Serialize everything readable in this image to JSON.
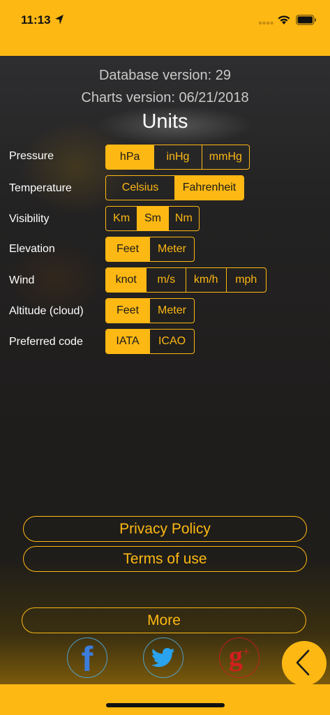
{
  "status_bar": {
    "time": "11:13",
    "icons": [
      "location-arrow-icon",
      "signal-dots-icon",
      "wifi-icon",
      "battery-icon"
    ]
  },
  "info": {
    "database_version": "Database version: 29",
    "charts_version": "Charts version: 06/21/2018"
  },
  "title": "Units",
  "settings": [
    {
      "label": "Pressure",
      "options": [
        "hPa",
        "inHg",
        "mmHg"
      ],
      "selected": 0
    },
    {
      "label": "Temperature",
      "options": [
        "Celsius",
        "Fahrenheit"
      ],
      "selected": 1
    },
    {
      "label": "Visibility",
      "options": [
        "Km",
        "Sm",
        "Nm"
      ],
      "selected": 1
    },
    {
      "label": "Elevation",
      "options": [
        "Feet",
        "Meter"
      ],
      "selected": 0
    },
    {
      "label": "Wind",
      "options": [
        "knot",
        "m/s",
        "km/h",
        "mph"
      ],
      "selected": 0
    },
    {
      "label": "Altitude (cloud)",
      "options": [
        "Feet",
        "Meter"
      ],
      "selected": 0
    },
    {
      "label": "Preferred code",
      "options": [
        "IATA",
        "ICAO"
      ],
      "selected": 0
    }
  ],
  "links": {
    "privacy_policy": "Privacy Policy",
    "terms_of_use": "Terms of use",
    "more": "More"
  },
  "social": {
    "facebook_glyph": "f",
    "twitter_icon": "twitter-bird-icon",
    "gplus_glyph": "g",
    "gplus_sup": "+"
  },
  "colors": {
    "accent": "#fdb813",
    "facebook": "#3b7ddd",
    "twitter": "#2aa3ef",
    "gplus": "#d21f1f"
  }
}
